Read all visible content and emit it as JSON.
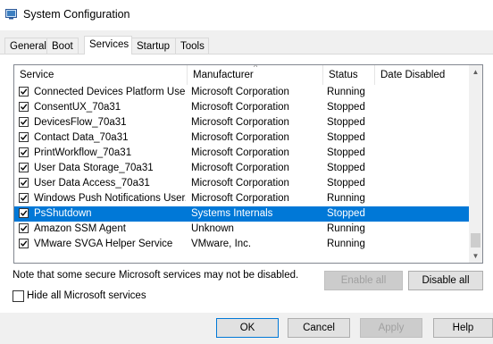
{
  "window": {
    "title": "System Configuration",
    "icon": "msconfig-icon"
  },
  "tabs": [
    {
      "label": "General",
      "active": false
    },
    {
      "label": "Boot",
      "active": false
    },
    {
      "label": "Services",
      "active": true
    },
    {
      "label": "Startup",
      "active": false
    },
    {
      "label": "Tools",
      "active": false
    }
  ],
  "columns": {
    "service": "Service",
    "manufacturer": "Manufacturer",
    "status": "Status",
    "date_disabled": "Date Disabled"
  },
  "rows": [
    {
      "service": "Connected Devices Platform Use...",
      "manufacturer": "Microsoft Corporation",
      "status": "Running",
      "date_disabled": "",
      "checked": true,
      "selected": false
    },
    {
      "service": "ConsentUX_70a31",
      "manufacturer": "Microsoft Corporation",
      "status": "Stopped",
      "date_disabled": "",
      "checked": true,
      "selected": false
    },
    {
      "service": "DevicesFlow_70a31",
      "manufacturer": "Microsoft Corporation",
      "status": "Stopped",
      "date_disabled": "",
      "checked": true,
      "selected": false
    },
    {
      "service": "Contact Data_70a31",
      "manufacturer": "Microsoft Corporation",
      "status": "Stopped",
      "date_disabled": "",
      "checked": true,
      "selected": false
    },
    {
      "service": "PrintWorkflow_70a31",
      "manufacturer": "Microsoft Corporation",
      "status": "Stopped",
      "date_disabled": "",
      "checked": true,
      "selected": false
    },
    {
      "service": "User Data Storage_70a31",
      "manufacturer": "Microsoft Corporation",
      "status": "Stopped",
      "date_disabled": "",
      "checked": true,
      "selected": false
    },
    {
      "service": "User Data Access_70a31",
      "manufacturer": "Microsoft Corporation",
      "status": "Stopped",
      "date_disabled": "",
      "checked": true,
      "selected": false
    },
    {
      "service": "Windows Push Notifications User...",
      "manufacturer": "Microsoft Corporation",
      "status": "Running",
      "date_disabled": "",
      "checked": true,
      "selected": false
    },
    {
      "service": "PsShutdown",
      "manufacturer": "Systems Internals",
      "status": "Stopped",
      "date_disabled": "",
      "checked": true,
      "selected": true
    },
    {
      "service": "Amazon SSM Agent",
      "manufacturer": "Unknown",
      "status": "Running",
      "date_disabled": "",
      "checked": true,
      "selected": false
    },
    {
      "service": "VMware SVGA Helper Service",
      "manufacturer": "VMware, Inc.",
      "status": "Running",
      "date_disabled": "",
      "checked": true,
      "selected": false
    }
  ],
  "note": "Note that some secure Microsoft services may not be disabled.",
  "enable_all": "Enable all",
  "disable_all": "Disable all",
  "hide_ms_label": "Hide all Microsoft services",
  "footer": {
    "ok": "OK",
    "cancel": "Cancel",
    "apply": "Apply",
    "help": "Help"
  },
  "colors": {
    "selection": "#0078d7",
    "window_bg": "#f0f0f0"
  }
}
